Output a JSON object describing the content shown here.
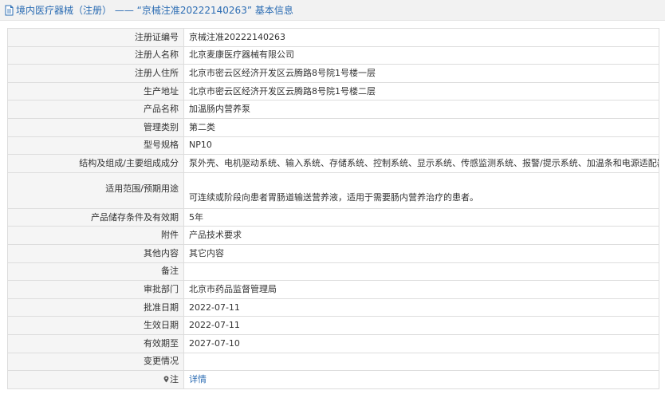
{
  "header": {
    "title": "境内医疗器械（注册） —— “京械注准20222140263” 基本信息"
  },
  "rows": [
    {
      "label": "注册证编号",
      "value": "京械注准20222140263"
    },
    {
      "label": "注册人名称",
      "value": "北京麦康医疗器械有限公司"
    },
    {
      "label": "注册人住所",
      "value": "北京市密云区经济开发区云腾路8号院1号楼一层"
    },
    {
      "label": "生产地址",
      "value": "北京市密云区经济开发区云腾路8号院1号楼二层"
    },
    {
      "label": "产品名称",
      "value": "加温肠内营养泵"
    },
    {
      "label": "管理类别",
      "value": "第二类"
    },
    {
      "label": "型号规格",
      "value": "NP10"
    },
    {
      "label": "结构及组成/主要组成成分",
      "value": "泵外壳、电机驱动系统、输入系统、存储系统、控制系统、显示系统、传感监测系统、报警/提示系统、加温条和电源适配器组成。"
    },
    {
      "label": "适用范围/预期用途",
      "value": "可连续或阶段向患者胃肠道输送营养液，适用于需要肠内营养治疗的患者。"
    },
    {
      "label": "产品储存条件及有效期",
      "value": "5年"
    },
    {
      "label": "附件",
      "value": "产品技术要求"
    },
    {
      "label": "其他内容",
      "value": "其它内容"
    },
    {
      "label": "备注",
      "value": ""
    },
    {
      "label": "审批部门",
      "value": "北京市药品监督管理局"
    },
    {
      "label": "批准日期",
      "value": "2022-07-11"
    },
    {
      "label": "生效日期",
      "value": "2022-07-11"
    },
    {
      "label": "有效期至",
      "value": "2027-07-10"
    },
    {
      "label": "变更情况",
      "value": ""
    },
    {
      "label": "注",
      "value": "详情"
    }
  ],
  "colors": {
    "link": "#2b6cb3",
    "label_bg": "#f5f5f5",
    "border": "#dddddd",
    "title_bg": "#f2f2f2"
  }
}
